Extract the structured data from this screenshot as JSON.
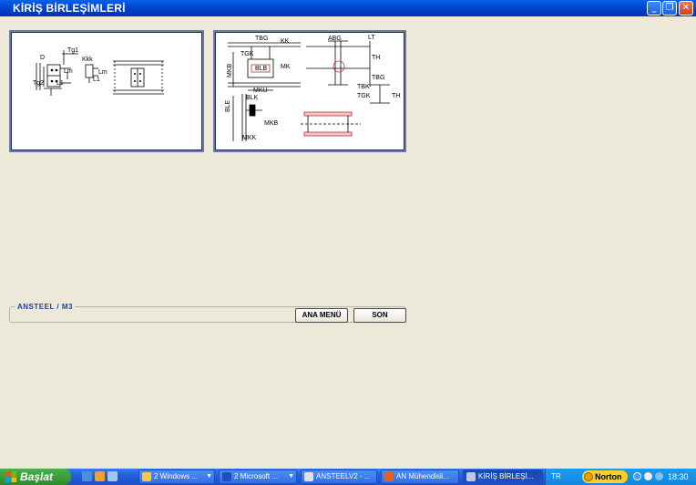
{
  "window": {
    "title": "KİRİŞ BİRLEŞİMLERİ",
    "minimize_glyph": "_",
    "maximize_glyph": "❐",
    "close_glyph": "✕"
  },
  "drawing1": {
    "labels": [
      "D",
      "Tg1",
      "Kkk",
      "Lm",
      "Lm",
      "Tg2",
      "L1",
      "L1"
    ]
  },
  "drawing2": {
    "labels": [
      "TBG",
      "KK",
      "ABG",
      "LT",
      "TGK",
      "MK",
      "MKB",
      "BLB",
      "TH",
      "MKU",
      "TBG",
      "TBK",
      "TGK",
      "TH",
      "BLK",
      "BLE",
      "MKB",
      "MKK"
    ]
  },
  "infobar": {
    "label": "ANSTEEL  / M3"
  },
  "buttons": {
    "main_menu": "ANA MENÜ",
    "exit": "SON"
  },
  "taskbar": {
    "start": "Başlat",
    "tasks": [
      {
        "label": "2 Windows ...",
        "icon": "folder-icon",
        "color": "#F4C850"
      },
      {
        "label": "2 Microsoft ...",
        "icon": "word-icon",
        "color": "#2050C0"
      },
      {
        "label": "ANSTEELV2 - ...",
        "icon": "document-icon",
        "color": "#E0E0E0"
      },
      {
        "label": "AN Mühendisli...",
        "icon": "app-icon",
        "color": "#E86020"
      },
      {
        "label": "KİRİŞ BİRLEŞİ...",
        "icon": "window-icon",
        "color": "#C0C8E0"
      }
    ],
    "language": "TR",
    "norton": "Norton",
    "clock": "18:30"
  }
}
